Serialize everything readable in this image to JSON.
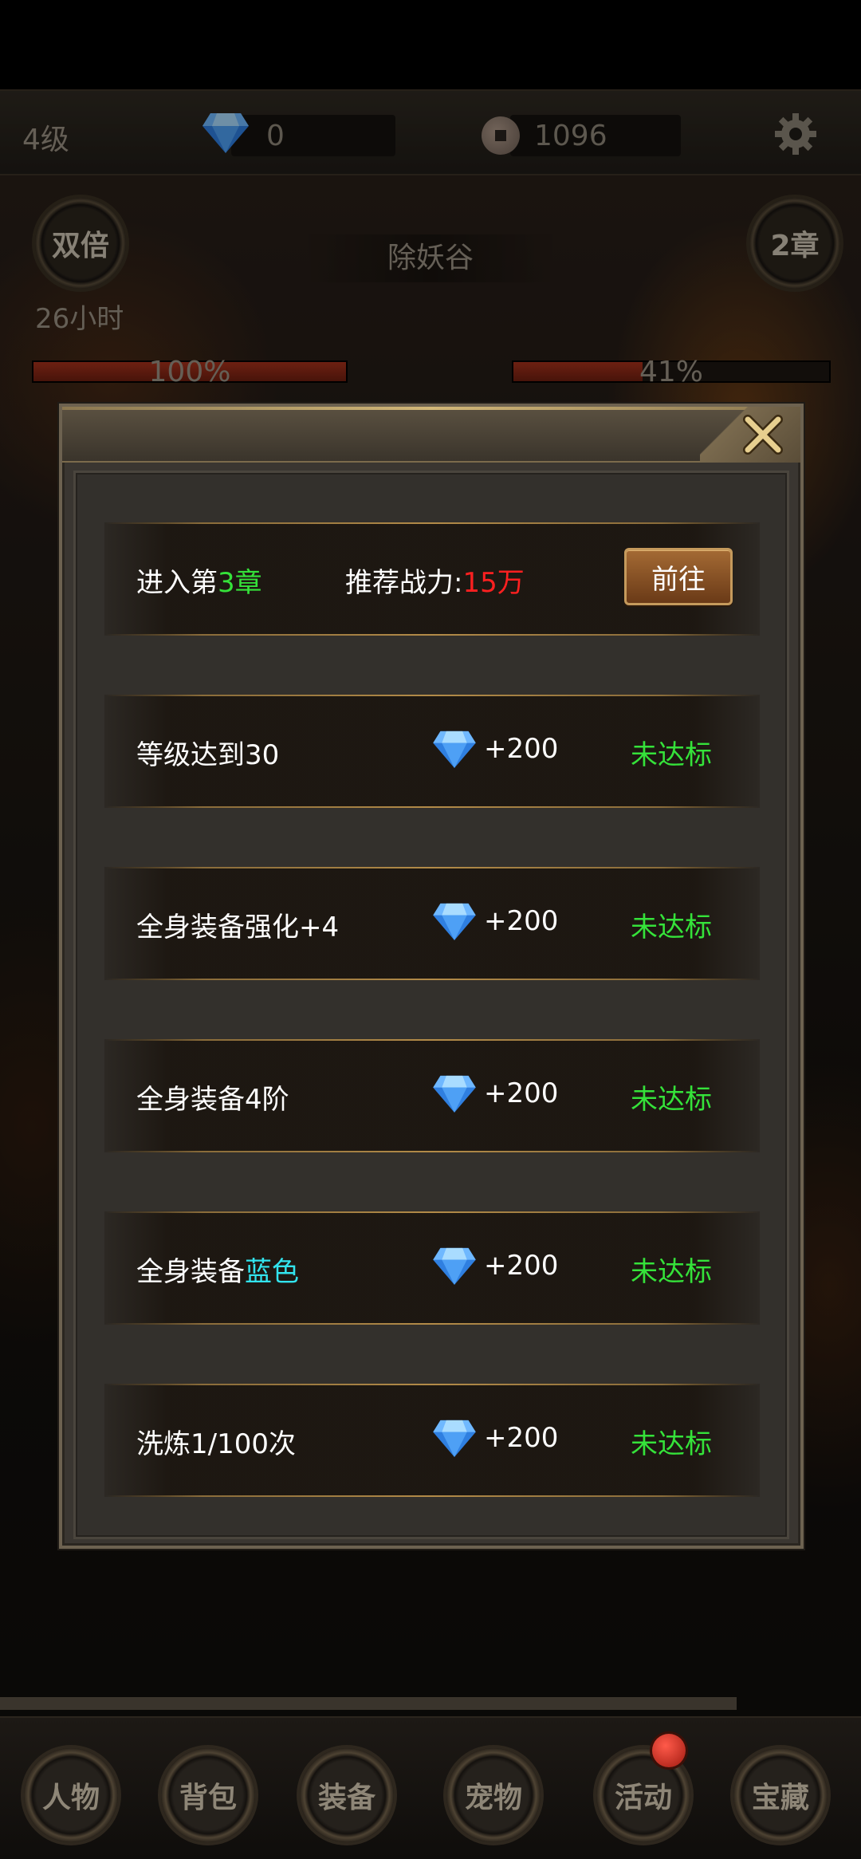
{
  "top_bar": {
    "level": "4级",
    "gem_count": "0",
    "coin_count": "1096"
  },
  "hud": {
    "double_label": "双倍",
    "chapter_label": "2章",
    "map_name": "除妖谷",
    "timer": "26小时",
    "progress_left_label": "100%",
    "progress_left_value": 100,
    "progress_right_label": "41%",
    "progress_right_value": 41
  },
  "dialog": {
    "chapter_row": {
      "prefix": "进入第",
      "chapter": "3章",
      "power_label": "推荐战力:",
      "power_value": "15万",
      "go_button": "前往"
    },
    "tasks": [
      {
        "text": "等级达到30",
        "highlight": "",
        "reward": "+200",
        "status": "未达标"
      },
      {
        "text": "全身装备强化+4",
        "highlight": "",
        "reward": "+200",
        "status": "未达标"
      },
      {
        "text": "全身装备4阶",
        "highlight": "",
        "reward": "+200",
        "status": "未达标"
      },
      {
        "text": "全身装备",
        "highlight": "蓝色",
        "reward": "+200",
        "status": "未达标"
      },
      {
        "text": "洗炼1/100次",
        "highlight": "",
        "reward": "+200",
        "status": "未达标"
      }
    ]
  },
  "bottom_nav": [
    "人物",
    "背包",
    "装备",
    "宠物",
    "活动",
    "宝藏"
  ],
  "colors": {
    "status_green": "#35e23a",
    "power_red": "#ff2020",
    "highlight_cyan": "#32e4ee",
    "button_brown": "#a46a34"
  },
  "icons": [
    "diamond-icon",
    "coin-icon",
    "gear-icon",
    "close-icon"
  ]
}
